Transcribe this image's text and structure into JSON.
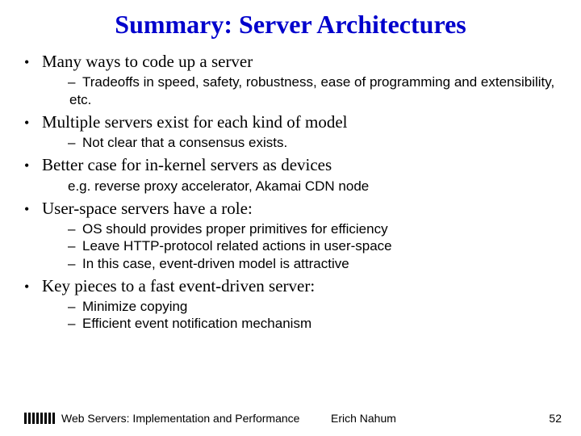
{
  "title": "Summary: Server Architectures",
  "bullets": {
    "b1": "Many ways to code up a server",
    "b1s1": "Tradeoffs in speed, safety, robustness, ease of programming and extensibility, etc.",
    "b2": "Multiple servers exist for each kind of model",
    "b2s1": "Not clear that a consensus exists.",
    "b3": "Better case for in-kernel servers as devices",
    "b3s1": "e.g. reverse proxy accelerator, Akamai CDN node",
    "b4": "User-space servers have a role:",
    "b4s1": "OS should provides proper primitives for efficiency",
    "b4s2": "Leave HTTP-protocol related actions in user-space",
    "b4s3": "In this case, event-driven model is attractive",
    "b5": "Key pieces to a fast event-driven server:",
    "b5s1": "Minimize copying",
    "b5s2": "Efficient event notification mechanism"
  },
  "footer": {
    "title": "Web Servers: Implementation and Performance",
    "author": "Erich Nahum",
    "page": "52"
  }
}
